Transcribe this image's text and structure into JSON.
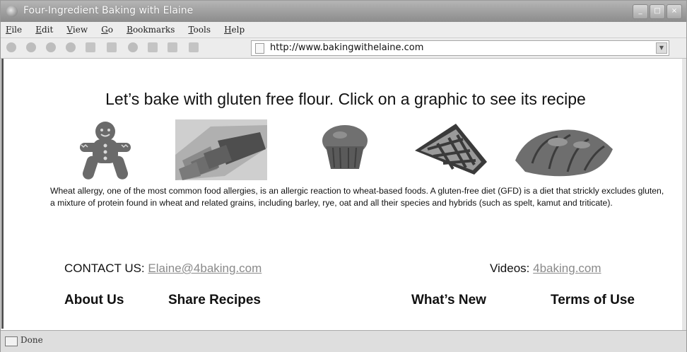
{
  "window": {
    "title": "Four-Ingredient Baking with Elaine"
  },
  "menu": [
    "File",
    "Edit",
    "View",
    "Go",
    "Bookmarks",
    "Tools",
    "Help"
  ],
  "address": {
    "url": "http://www.bakingwithelaine.com"
  },
  "page": {
    "headline": "Let’s bake with gluten free flour. Click on a graphic to see its recipe",
    "recipes": [
      {
        "icon": "gingerbread-man-icon"
      },
      {
        "icon": "bread-loaf-icon"
      },
      {
        "icon": "muffin-icon"
      },
      {
        "icon": "pie-slice-icon"
      },
      {
        "icon": "croissant-icon"
      }
    ],
    "paragraph": "Wheat allergy, one of the most common food allergies, is an allergic reaction to wheat-based foods. A gluten-free diet (GFD) is a diet that strickly excludes gluten, a mixture of protein found in wheat and related grains, including barley, rye, oat and all their species and hybrids (such as spelt, kamut and triticate).",
    "contact_label": "CONTACT US:",
    "contact_email": "Elaine@4baking.com",
    "videos_label": "Videos:",
    "videos_link": "4baking.com",
    "nav": {
      "about": "About Us",
      "share": "Share Recipes",
      "new": "What’s New",
      "terms": "Terms of Use"
    }
  },
  "status": {
    "text": "Done"
  }
}
